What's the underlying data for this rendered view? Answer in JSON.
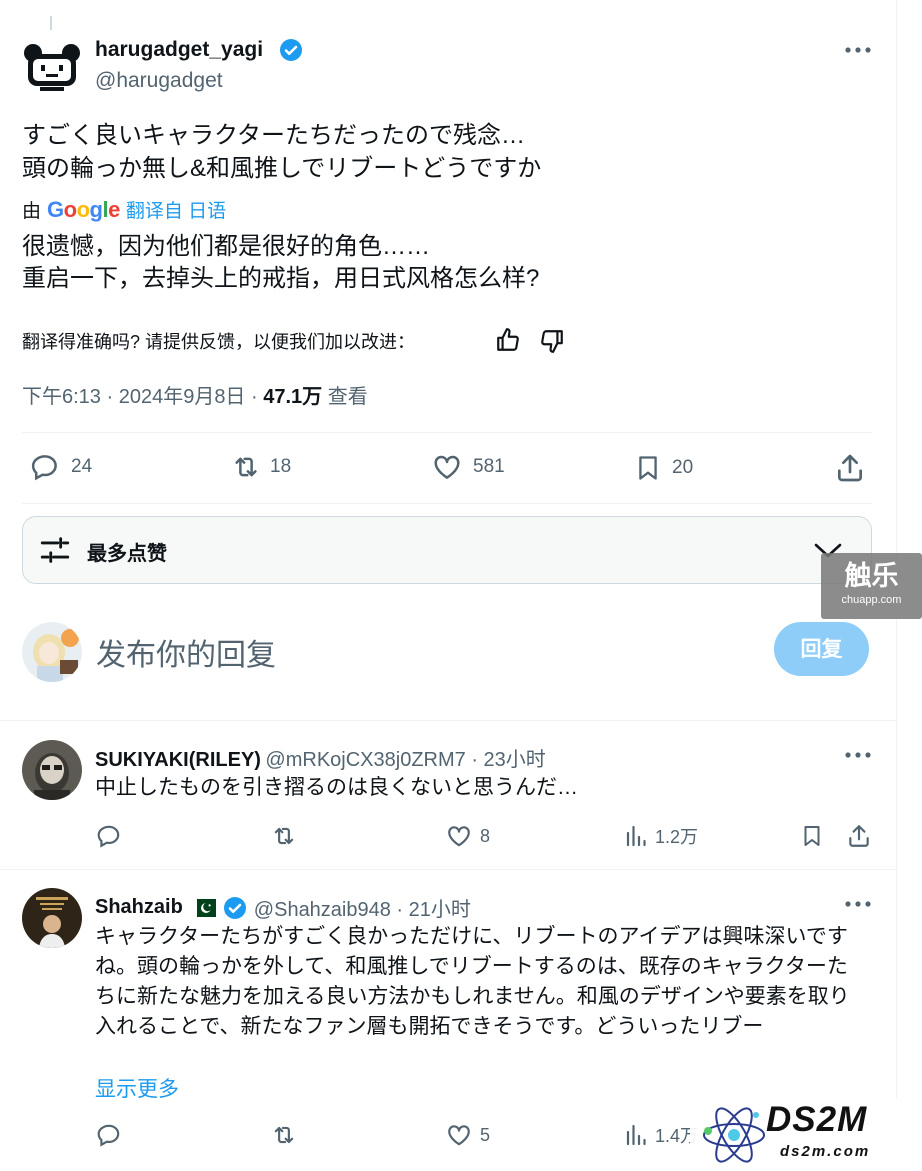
{
  "post": {
    "display_name": "harugadget_yagi",
    "handle": "@harugadget",
    "text_lines": [
      "すごく良いキャラクターたちだったので残念…",
      "頭の輪っか無し&和風推しでリブートどうですか"
    ],
    "translated_by": "由",
    "translation_provider": "Google",
    "translation_source": "翻译自 日语",
    "translation_lines": [
      "很遗憾，因为他们都是很好的角色……",
      "重启一下，去掉头上的戒指，用日式风格怎么样?"
    ],
    "feedback_prompt": "翻译得准确吗? 请提供反馈，以便我们加以改进：",
    "timestamp": "下午6:13 · 2024年9月8日 · ",
    "views_count": "47.1万",
    "views_label": " 查看",
    "stats": {
      "replies": "24",
      "reposts": "18",
      "likes": "581",
      "bookmarks": "20"
    }
  },
  "sort": {
    "label": "最多点赞"
  },
  "composer": {
    "placeholder": "发布你的回复",
    "reply_button": "回复"
  },
  "replies": [
    {
      "name": "SUKIYAKI(RILEY)",
      "handle_time": "@mRKojCX38j0ZRM7 · 23小时",
      "text": "中止したものを引き摺るのは良くないと思うんだ…",
      "likes": "8",
      "views": "1.2万"
    },
    {
      "name": "Shahzaib",
      "handle_time": "@Shahzaib948 · 21小时",
      "text": "キャラクターたちがすごく良かっただけに、リブートのアイデアは興味深いですね。頭の輪っかを外して、和風推しでリブートするのは、既存のキャラクターたちに新たな魅力を加える良い方法かもしれません。和風のデザインや要素を取り入れることで、新たなファン層も開拓できそうです。どういったリブー",
      "show_more": "显示更多",
      "likes": "5",
      "views": "1.4万"
    }
  ],
  "watermark_chuapp": {
    "title": "触乐",
    "url": "chuapp.com"
  },
  "watermark_ds2m": {
    "title": "DS2M",
    "url": "ds2m.com"
  },
  "colors": {
    "accent": "#1d9bf0",
    "reply_button": "#8ecdf8",
    "muted": "#536471",
    "border": "#eff3f4"
  }
}
